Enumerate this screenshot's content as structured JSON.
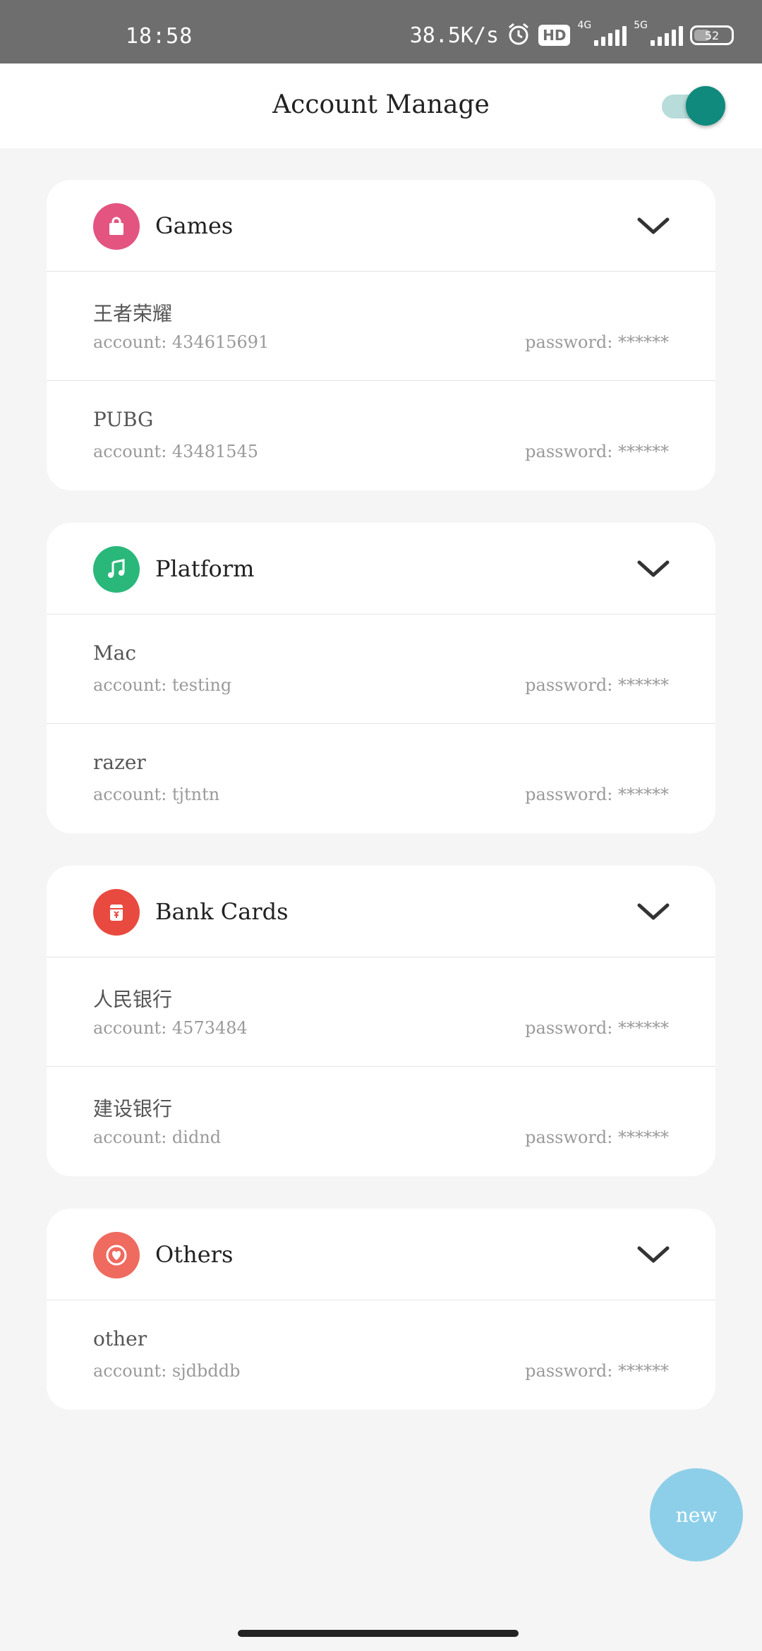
{
  "status_bar": {
    "time": "18:58",
    "net_speed": "38.5K/s",
    "hd_badge": "HD",
    "net_4g": "4G",
    "net_5g": "5G",
    "battery": "52"
  },
  "header": {
    "title": "Account Manage"
  },
  "categories": [
    {
      "title": "Games",
      "icon": "shopping-bag-icon",
      "color": "#e45481",
      "items": [
        {
          "name": "王者荣耀",
          "account": "account: 434615691",
          "password": "password: ******"
        },
        {
          "name": "PUBG",
          "account": "account: 43481545",
          "password": "password: ******"
        }
      ]
    },
    {
      "title": "Platform",
      "icon": "music-note-icon",
      "color": "#2ab87a",
      "items": [
        {
          "name": "Mac",
          "account": "account: testing",
          "password": "password: ******"
        },
        {
          "name": "razer",
          "account": "account: tjtntn",
          "password": "password: ******"
        }
      ]
    },
    {
      "title": "Bank Cards",
      "icon": "bank-card-icon",
      "color": "#e94a3f",
      "items": [
        {
          "name": "人民银行",
          "account": "account: 4573484",
          "password": "password: ******"
        },
        {
          "name": "建设银行",
          "account": "account: didnd",
          "password": "password: ******"
        }
      ]
    },
    {
      "title": "Others",
      "icon": "heart-icon",
      "color": "#ef6a5f",
      "items": [
        {
          "name": "other",
          "account": "account: sjdbddb",
          "password": "password: ******"
        }
      ]
    }
  ],
  "fab": {
    "label": "new"
  }
}
